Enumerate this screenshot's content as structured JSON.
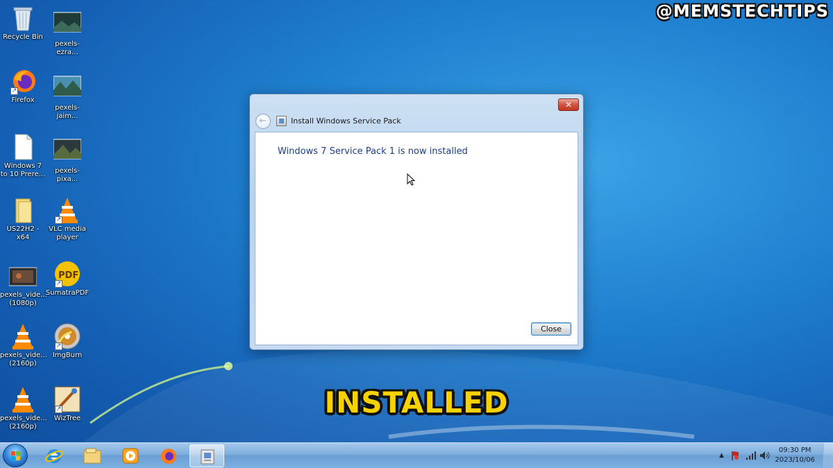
{
  "watermark": "@MEMSTECHTIPS",
  "caption": "INSTALLED",
  "desktop_icons": [
    {
      "label_1": "Recycle Bin",
      "label_2": "",
      "icon": "recycle-bin-icon"
    },
    {
      "label_1": "pexels-ezra...",
      "label_2": "",
      "icon": "image-file-icon"
    },
    {
      "label_1": "Firefox",
      "label_2": "",
      "icon": "firefox-icon"
    },
    {
      "label_1": "pexels-jaim...",
      "label_2": "",
      "icon": "image-file-icon"
    },
    {
      "label_1": "Windows 7",
      "label_2": "to 10 Prere...",
      "icon": "document-icon"
    },
    {
      "label_1": "pexels-pixa...",
      "label_2": "",
      "icon": "image-file-icon"
    },
    {
      "label_1": "US22H2 - x64",
      "label_2": "",
      "icon": "folder-icon"
    },
    {
      "label_1": "VLC media",
      "label_2": "player",
      "icon": "vlc-icon"
    },
    {
      "label_1": "pexels_vide...",
      "label_2": "(1080p)",
      "icon": "video-file-icon"
    },
    {
      "label_1": "SumatraPDF",
      "label_2": "",
      "icon": "pdf-icon"
    },
    {
      "label_1": "pexels_vide...",
      "label_2": "(2160p)",
      "icon": "vlc-icon"
    },
    {
      "label_1": "ImgBurn",
      "label_2": "",
      "icon": "disc-icon"
    },
    {
      "label_1": "pexels_vide...",
      "label_2": "(2160p)",
      "icon": "vlc-icon"
    },
    {
      "label_1": "WizTree",
      "label_2": "",
      "icon": "wiztree-icon"
    }
  ],
  "dialog": {
    "title": "Install Windows Service Pack",
    "message": "Windows 7 Service Pack 1 is now installed",
    "close_button": "Close",
    "close_glyph": "✕",
    "back_glyph": "←"
  },
  "taskbar": {
    "pinned": [
      "internet-explorer-icon",
      "explorer-folder-icon",
      "media-player-icon",
      "firefox-icon",
      "installer-icon"
    ],
    "tray": {
      "expand_glyph": "▲",
      "time": "09:30 PM",
      "date": "2023/10/06"
    }
  },
  "colors": {
    "desktop_blue": "#1f7fcf",
    "dialog_heading": "#1e3f8a",
    "caption_yellow": "#f6d200"
  }
}
